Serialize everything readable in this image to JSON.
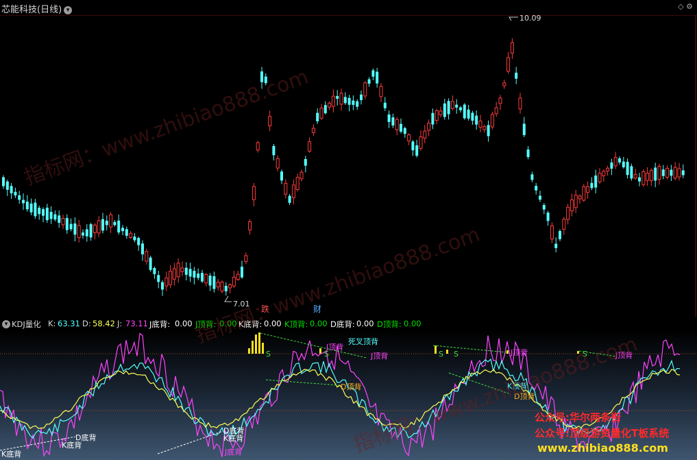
{
  "header": {
    "title": "芯能科技(日线)",
    "right_icons": "◇ ⚙"
  },
  "price_chart": {
    "high_label": "10.09",
    "low_label": "7.01",
    "marker_red": "跌",
    "marker_blue": "财",
    "colors": {
      "up": "#ff3c3c",
      "down": "#54ffff",
      "bg": "#000000"
    }
  },
  "indicator": {
    "name": "KDJ量化",
    "k_label": "K:",
    "k_value": "63.31",
    "d_label": "D:",
    "d_value": "58.42",
    "j_label": "J:",
    "j_value": "73.11",
    "fields": [
      {
        "label": "J底背:",
        "value": "0.00",
        "color": "#ffffff"
      },
      {
        "label": "J顶背:",
        "value": "0.00",
        "color": "#00e000"
      },
      {
        "label": "K底背:",
        "value": "0.00",
        "color": "#ffffff"
      },
      {
        "label": "K顶背:",
        "value": "0.00",
        "color": "#00e000"
      },
      {
        "label": "D底背:",
        "value": "0.00",
        "color": "#ffffff"
      },
      {
        "label": "D顶背:",
        "value": "0.00",
        "color": "#00e000"
      }
    ],
    "annotations": {
      "dead_cross": "死叉顶背",
      "j_top": "J顶背",
      "k_top": "K顶背",
      "d_top": "D顶背",
      "s": "S",
      "k_bottom": "K底背",
      "d_bottom": "D底背",
      "j_bottom": "J底背"
    }
  },
  "watermark": {
    "text": "指标网：www.zhibiao888.com"
  },
  "promo": {
    "line1": "公众号:华尔两条街",
    "line2": "公众号:顶级游资量化T板系统",
    "line3": "www.zhibiao888.com"
  }
}
